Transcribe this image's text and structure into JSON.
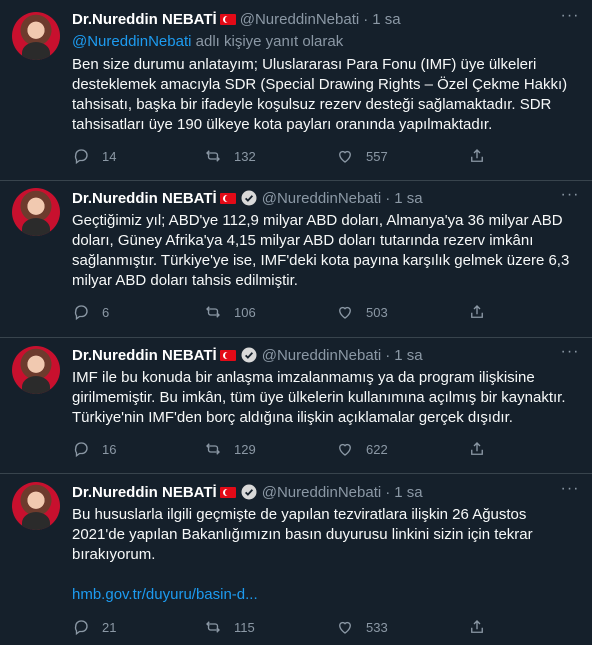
{
  "colors": {
    "background": "#15202b",
    "accent": "#1d9bf0",
    "muted": "#8b98a5",
    "text": "#f7f9f9"
  },
  "tweets": [
    {
      "name": "Dr.Nureddin NEBATİ",
      "handle": "@NureddinNebati",
      "time": "1 sa",
      "reply_to_mention": "@NureddinNebati",
      "reply_to_suffix": " adlı kişiye yanıt olarak",
      "text": "Ben size durumu anlatayım; Uluslararası Para Fonu (IMF) üye ülkeleri desteklemek amacıyla SDR (Special Drawing Rights – Özel Çekme Hakkı) tahsisatı, başka bir ifadeyle koşulsuz rezerv desteği sağlamaktadır. SDR tahsisatları üye 190 ülkeye kota payları oranında yapılmaktadır.",
      "replies": "14",
      "retweets": "132",
      "likes": "557"
    },
    {
      "name": "Dr.Nureddin NEBATİ",
      "handle": "@NureddinNebati",
      "time": "1 sa",
      "text": "Geçtiğimiz yıl; ABD'ye 112,9 milyar ABD doları, Almanya'ya 36 milyar ABD doları, Güney Afrika'ya 4,15 milyar ABD doları tutarında rezerv imkânı sağlanmıştır. Türkiye'ye ise, IMF'deki kota payına karşılık gelmek üzere 6,3 milyar ABD doları tahsis edilmiştir.",
      "replies": "6",
      "retweets": "106",
      "likes": "503"
    },
    {
      "name": "Dr.Nureddin NEBATİ",
      "handle": "@NureddinNebati",
      "time": "1 sa",
      "text": "IMF ile bu konuda bir anlaşma imzalanmamış ya da program ilişkisine girilmemiştir. Bu imkân, tüm üye ülkelerin kullanımına açılmış bir kaynaktır. Türkiye'nin IMF'den borç aldığına ilişkin açıklamalar gerçek dışıdır.",
      "replies": "16",
      "retweets": "129",
      "likes": "622"
    },
    {
      "name": "Dr.Nureddin NEBATİ",
      "handle": "@NureddinNebati",
      "time": "1 sa",
      "text": "Bu hususlarla ilgili geçmişte de yapılan tezviratlara ilişkin 26 Ağustos 2021'de yapılan Bakanlığımızın basın duyurusu linkini sizin için tekrar bırakıyorum.",
      "link": "hmb.gov.tr/duyuru/basin-d...",
      "replies": "21",
      "retweets": "115",
      "likes": "533"
    }
  ]
}
